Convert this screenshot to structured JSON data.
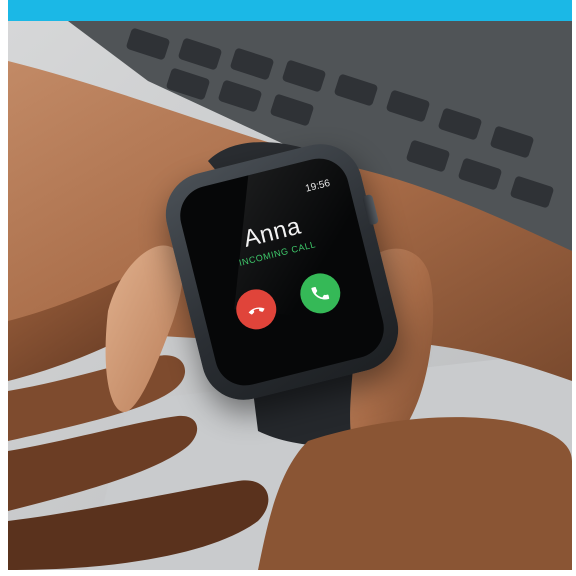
{
  "colors": {
    "top_bar": "#1bb8e6",
    "decline": "#e0443a",
    "accept": "#35b957",
    "status_text": "#3ec86a",
    "screen": "#060708"
  },
  "watch": {
    "time": "19:56",
    "caller_name": "Anna",
    "call_status": "INCOMING CALL",
    "decline_icon": "phone-hangup-icon",
    "accept_icon": "phone-icon"
  }
}
